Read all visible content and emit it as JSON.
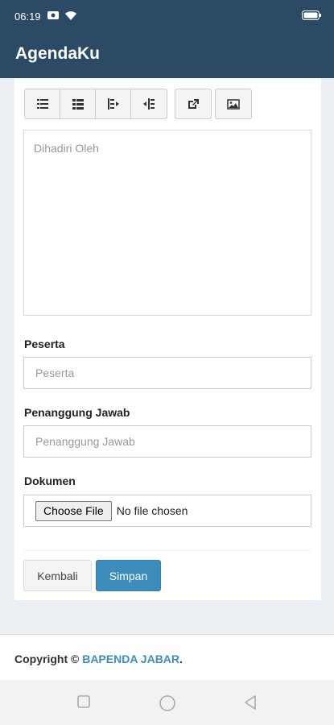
{
  "status_bar": {
    "time": "06:19"
  },
  "app": {
    "title": "AgendaKu"
  },
  "form": {
    "attendees_placeholder": "Dihadiri Oleh",
    "peserta_label": "Peserta",
    "peserta_placeholder": "Peserta",
    "pj_label": "Penanggung Jawab",
    "pj_placeholder": "Penanggung Jawab",
    "dokumen_label": "Dokumen",
    "choose_file_label": "Choose File",
    "no_file_text": "No file chosen",
    "back_label": "Kembali",
    "save_label": "Simpan"
  },
  "toolbar": {
    "icons": [
      "unordered-list-icon",
      "ordered-list-icon",
      "outdent-icon",
      "indent-icon",
      "link-icon",
      "image-icon"
    ]
  },
  "footer": {
    "prefix": "Copyright © ",
    "brand": "BAPENDA JABAR",
    "suffix": "."
  },
  "colors": {
    "header": "#2c4a66",
    "primary": "#3c8dbc",
    "page_bg": "#ecf0f5"
  }
}
